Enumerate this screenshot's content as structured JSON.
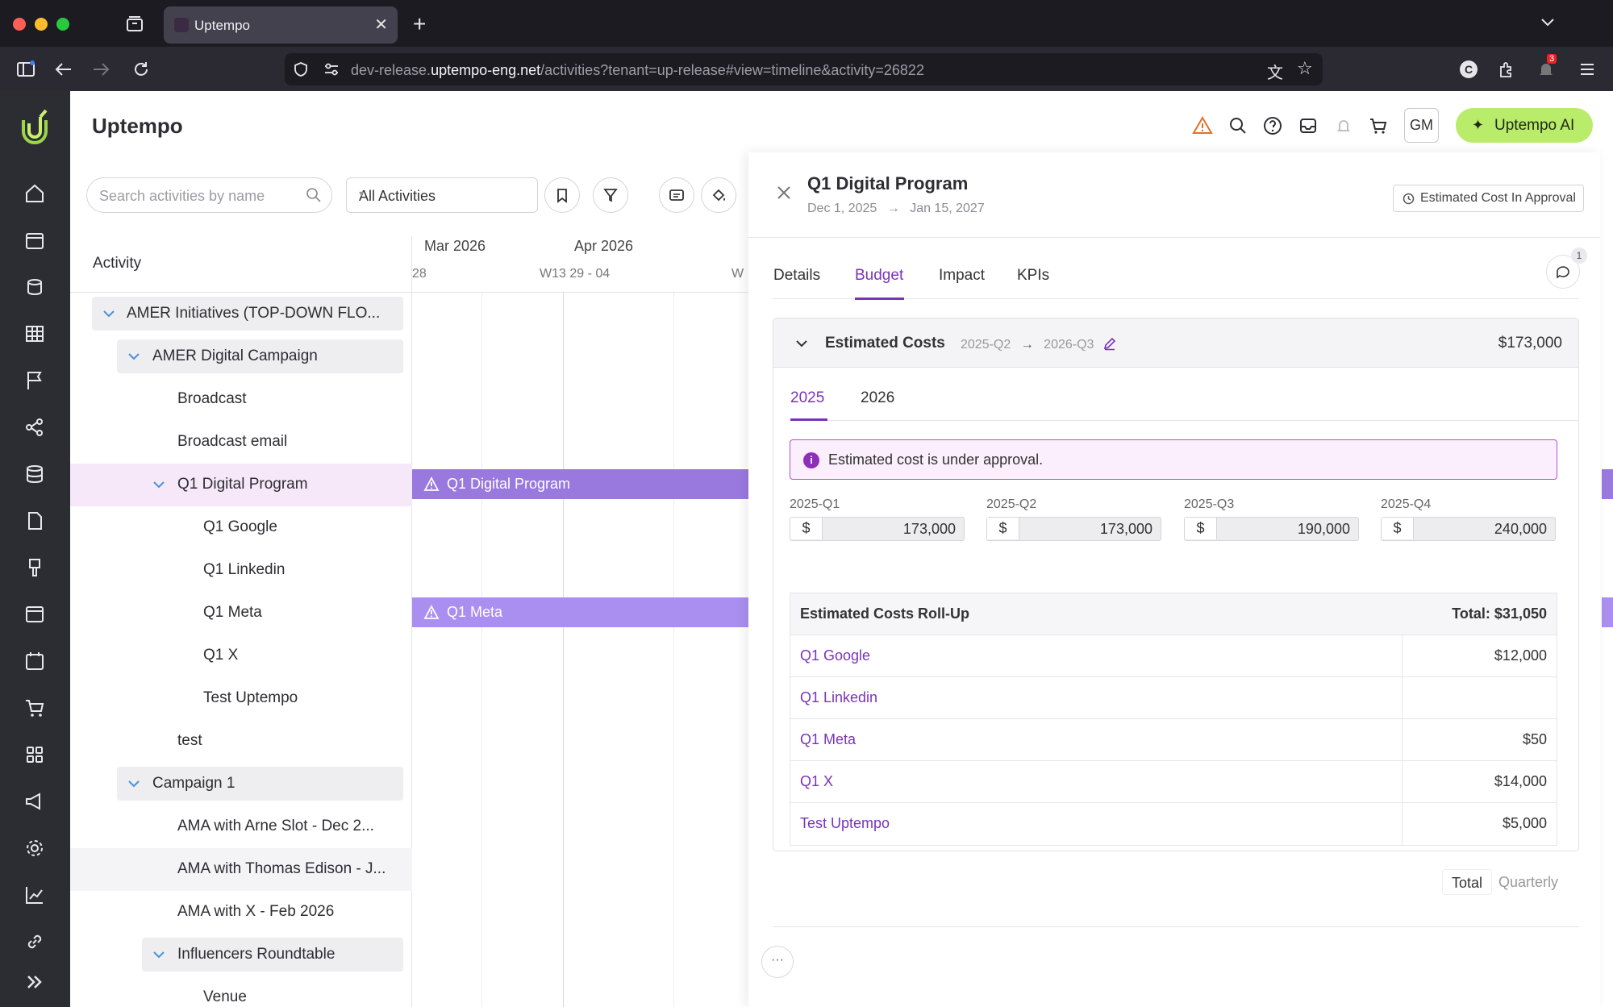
{
  "browser": {
    "tab_title": "Uptempo",
    "url_prefix": "dev-release.",
    "url_domain": "uptempo-eng.net",
    "url_path": "/activities?tenant=up-release#view=timeline&activity=26822",
    "notification_count": "3"
  },
  "app": {
    "title": "Uptempo",
    "user_initials": "GM",
    "ai_button": "Uptempo AI"
  },
  "toolbar": {
    "search_placeholder": "Search activities by name",
    "filter_select": "All Activities"
  },
  "tree": {
    "header": "Activity",
    "rows": [
      {
        "label": "AMER Initiatives (TOP-DOWN FLO...",
        "expanded": true
      },
      {
        "label": "AMER Digital Campaign",
        "expanded": true
      },
      {
        "label": "Broadcast"
      },
      {
        "label": "Broadcast email"
      },
      {
        "label": "Q1 Digital Program",
        "expanded": true,
        "selected": true
      },
      {
        "label": "Q1 Google"
      },
      {
        "label": "Q1 Linkedin"
      },
      {
        "label": "Q1 Meta"
      },
      {
        "label": "Q1 X"
      },
      {
        "label": "Test Uptempo"
      },
      {
        "label": "test"
      },
      {
        "label": "Campaign 1",
        "expanded": true
      },
      {
        "label": "AMA with Arne Slot - Dec 2..."
      },
      {
        "label": "AMA with Thomas Edison - J..."
      },
      {
        "label": "AMA with X - Feb 2026"
      },
      {
        "label": "Influencers Roundtable",
        "expanded": true
      },
      {
        "label": "Venue"
      }
    ]
  },
  "timeline": {
    "months": [
      "Mar 2026",
      "Apr 2026"
    ],
    "weeks": [
      "28",
      "W13 29 - 04",
      "W"
    ],
    "bars": [
      "Q1 Digital Program",
      "Q1 Meta"
    ]
  },
  "drawer": {
    "title": "Q1 Digital Program",
    "start_date": "Dec 1, 2025",
    "end_date": "Jan 15, 2027",
    "arrow": "→",
    "status": "Estimated Cost In Approval",
    "tabs": [
      "Details",
      "Budget",
      "Impact",
      "KPIs"
    ],
    "active_tab": "Budget",
    "comment_count": "1",
    "estimated_costs": {
      "title": "Estimated Costs",
      "period_start": "2025-Q2",
      "period_end": "2026-Q3",
      "amount": "$173,000",
      "years": [
        "2025",
        "2026"
      ],
      "active_year": "2025",
      "alert": "Estimated cost is under approval.",
      "quarters": [
        {
          "label": "2025-Q1",
          "currency": "$",
          "value": "173,000"
        },
        {
          "label": "2025-Q2",
          "currency": "$",
          "value": "173,000"
        },
        {
          "label": "2025-Q3",
          "currency": "$",
          "value": "190,000"
        },
        {
          "label": "2025-Q4",
          "currency": "$",
          "value": "240,000"
        }
      ],
      "rollup": {
        "title": "Estimated Costs Roll-Up",
        "total": "Total: $31,050",
        "rows": [
          {
            "name": "Q1 Google",
            "value": "$12,000"
          },
          {
            "name": "Q1 Linkedin",
            "value": ""
          },
          {
            "name": "Q1 Meta",
            "value": "$50"
          },
          {
            "name": "Q1 X",
            "value": "$14,000"
          },
          {
            "name": "Test Uptempo",
            "value": "$5,000"
          }
        ]
      }
    },
    "view_toggle": [
      "Total",
      "Quarterly"
    ],
    "more": "···"
  },
  "colors": {
    "accent": "#7a33b8",
    "bar": "#9a79de",
    "ai_button": "#b8ec6a",
    "rail": "#2c2d33"
  }
}
